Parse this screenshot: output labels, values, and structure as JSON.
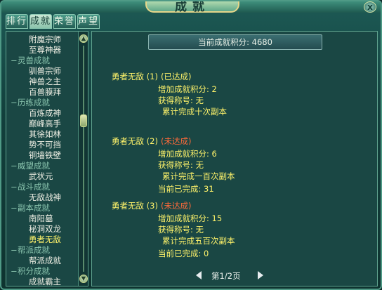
{
  "window": {
    "title": "成就",
    "close_glyph": "x"
  },
  "tabs": [
    {
      "label": "排行"
    },
    {
      "label": "成就",
      "active": true
    },
    {
      "label": "荣誉"
    },
    {
      "label": "声望"
    }
  ],
  "tree": [
    {
      "kind": "leaf",
      "label": "附魔宗师"
    },
    {
      "kind": "leaf",
      "label": "至尊神器"
    },
    {
      "kind": "cat",
      "sign": "−",
      "label": "灵兽成就"
    },
    {
      "kind": "leaf",
      "label": "驯兽宗师"
    },
    {
      "kind": "leaf",
      "label": "神兽之主"
    },
    {
      "kind": "leaf",
      "label": "百兽膜拜"
    },
    {
      "kind": "cat",
      "sign": "−",
      "label": "历练成就"
    },
    {
      "kind": "leaf",
      "label": "百炼成神"
    },
    {
      "kind": "leaf",
      "label": "巅峰高手"
    },
    {
      "kind": "leaf",
      "label": "其徐如林"
    },
    {
      "kind": "leaf",
      "label": "势不可挡"
    },
    {
      "kind": "leaf",
      "label": "铜墙铁壁"
    },
    {
      "kind": "cat",
      "sign": "−",
      "label": "威望成就"
    },
    {
      "kind": "leaf",
      "label": "武状元"
    },
    {
      "kind": "cat",
      "sign": "−",
      "label": "战斗成就"
    },
    {
      "kind": "leaf",
      "label": "无敌战神"
    },
    {
      "kind": "cat",
      "sign": "−",
      "label": "副本成就"
    },
    {
      "kind": "leaf",
      "label": "南阳墓"
    },
    {
      "kind": "leaf",
      "label": "秘洞双龙"
    },
    {
      "kind": "leaf",
      "label": "勇者无敌",
      "selected": true
    },
    {
      "kind": "cat",
      "sign": "−",
      "label": "帮派成就"
    },
    {
      "kind": "leaf",
      "label": "帮派成就"
    },
    {
      "kind": "cat",
      "sign": "−",
      "label": "积分成就"
    },
    {
      "kind": "leaf",
      "label": "成就霸主"
    }
  ],
  "score": {
    "label": "当前成就积分: ",
    "value": "4680"
  },
  "achievements": [
    {
      "name": "勇者无敌 (1)",
      "status": "(已达成)",
      "status_kind": "done",
      "points": "增加成就积分: 2",
      "title": "获得称号: 无",
      "desc": "累计完成十次副本",
      "progress": ""
    },
    {
      "name": "勇者无敌 (2)",
      "status": "(未达成)",
      "status_kind": "undone",
      "points": "增加成就积分: 6",
      "title": "获得称号: 无",
      "desc": "累计完成一百次副本",
      "progress": "当前已完成: 31"
    },
    {
      "name": "勇者无敌 (3)",
      "status": "(未达成)",
      "status_kind": "undone",
      "points": "增加成就积分: 15",
      "title": "获得称号: 无",
      "desc": "累计完成五百次副本",
      "progress": "当前已完成: 0"
    }
  ],
  "pager": {
    "text": "第1/2页"
  },
  "colors": {
    "highlight": "#fff36a",
    "undone": "#ff6a3a",
    "category": "#8cc7b0",
    "panel": "#1a4744"
  }
}
